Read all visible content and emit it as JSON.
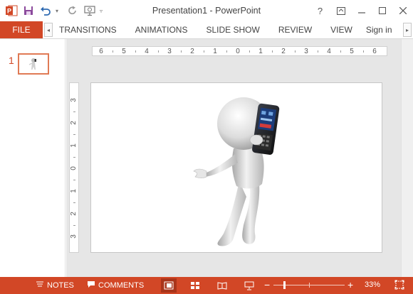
{
  "window": {
    "title": "Presentation1 - PowerPoint",
    "controls": [
      "help-icon",
      "restore-ribbon-icon",
      "minimize-icon",
      "maximize-icon",
      "close-icon"
    ]
  },
  "quick_access": {
    "icons": [
      "powerpoint-logo-icon",
      "save-icon",
      "undo-icon",
      "redo-icon",
      "start-from-beginning-icon",
      "customize-toolbar-icon"
    ]
  },
  "ribbon": {
    "file_label": "FILE",
    "tabs": [
      "TRANSITIONS",
      "ANIMATIONS",
      "SLIDE SHOW",
      "REVIEW",
      "VIEW"
    ],
    "sign_in_label": "Sign in"
  },
  "thumbnails": [
    {
      "number": "1",
      "content": "3d-figure-phone"
    }
  ],
  "rulers": {
    "horizontal": [
      "6",
      "5",
      "4",
      "3",
      "2",
      "1",
      "0",
      "1",
      "2",
      "3",
      "4",
      "5",
      "6"
    ],
    "vertical": [
      "3",
      "2",
      "1",
      "0",
      "1",
      "2",
      "3"
    ]
  },
  "slide": {
    "image": "3d-stick-figure-talking-on-cell-phone"
  },
  "statusbar": {
    "notes_label": "NOTES",
    "comments_label": "COMMENTS",
    "zoom_level": "33%",
    "views": [
      "normal-view-icon",
      "slide-sorter-icon",
      "reading-view-icon",
      "slide-show-icon"
    ],
    "active_view": "normal-view-icon"
  },
  "colors": {
    "accent": "#d24726",
    "accent_dark": "#a9341a"
  }
}
